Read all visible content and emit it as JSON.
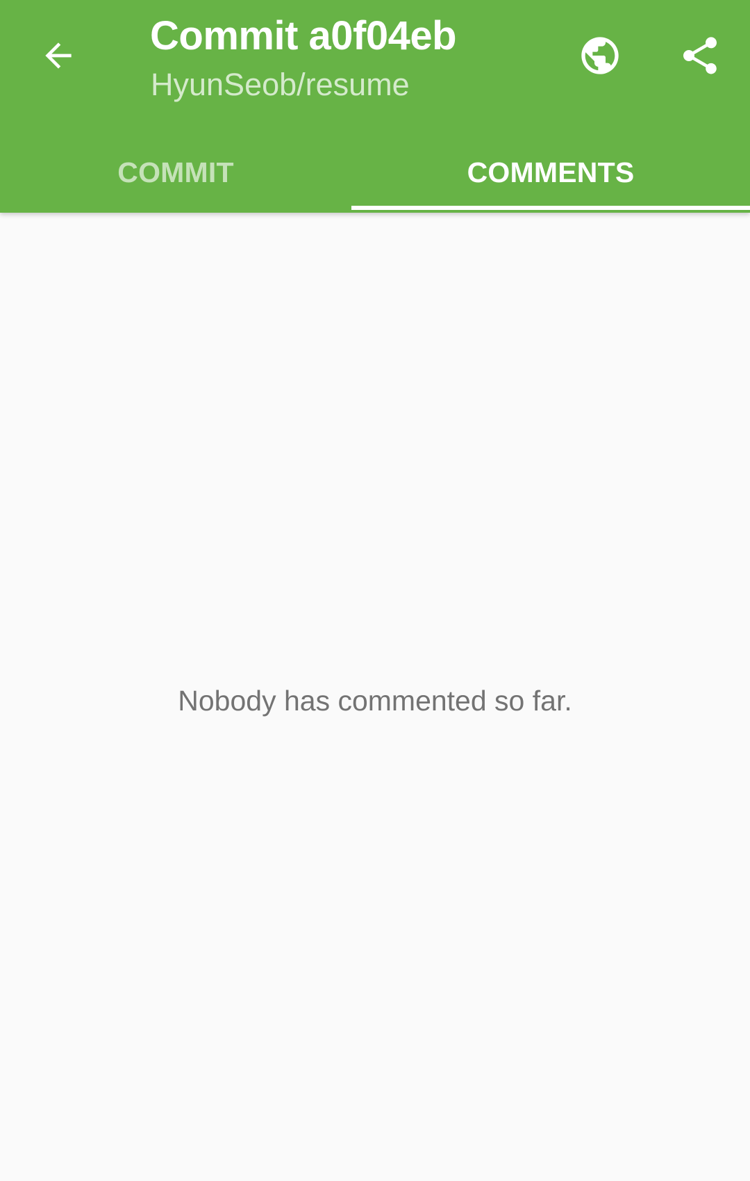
{
  "toolbar": {
    "title": "Commit a0f04eb",
    "subtitle": "HyunSeob/resume",
    "back_icon": "arrow-back-icon",
    "actions": [
      {
        "name": "browser",
        "icon": "globe-icon"
      },
      {
        "name": "share",
        "icon": "share-icon"
      }
    ]
  },
  "tabs": [
    {
      "label": "COMMIT",
      "selected": false
    },
    {
      "label": "COMMENTS",
      "selected": true
    }
  ],
  "main": {
    "empty_message": "Nobody has commented so far."
  },
  "colors": {
    "app_bar": "#67b346",
    "background": "#fafafa",
    "text_secondary": "#737373"
  }
}
